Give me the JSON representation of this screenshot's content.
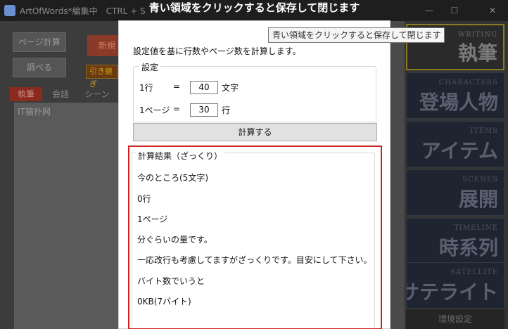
{
  "app": {
    "title": "ArtOfWords*編集中　CTRL + S",
    "min_icon": "minimize-icon",
    "max_icon": "maximize-icon",
    "close_icon": "close-icon",
    "buttons": {
      "page_calc": "ページ計算",
      "new": "新規",
      "lookup": "調べる",
      "quote": "引き継ぎ"
    },
    "tabs": [
      "執筆",
      "会話",
      "シーン"
    ],
    "editor_text": "IT猫扑网",
    "side_cards": [
      {
        "en": "WRITING",
        "jp": "執筆"
      },
      {
        "en": "CHARACTERS",
        "jp": "登場人物"
      },
      {
        "en": "ITEMS",
        "jp": "アイテム"
      },
      {
        "en": "SCENES",
        "jp": "展開"
      },
      {
        "en": "TIMELINE",
        "jp": "時系列"
      },
      {
        "en": "SATELLITE",
        "jp": "サテライト"
      }
    ],
    "bottom_button": "環境設定"
  },
  "banner": {
    "text": "青い領域をクリックすると保存して閉じます"
  },
  "tooltip": {
    "text": "青い領域をクリックすると保存して閉じます"
  },
  "dialog": {
    "description": "設定値を基に行数やページ数を計算します。",
    "settings": {
      "legend": "設定",
      "line_label": "1行",
      "line_eq": "=",
      "line_value": "40",
      "line_unit": "文字",
      "page_label": "1ページ",
      "page_eq": "=",
      "page_value": "30",
      "page_unit": "行"
    },
    "calc_button": "計算する",
    "results": {
      "legend": "計算結果（ざっくり）",
      "lines": [
        "今のところ(5文字)",
        "0行",
        "1ページ",
        "分ぐらいの量です。",
        "一応改行も考慮してますがざっくりです。目安にして下さい。",
        "バイト数でいうと",
        "0KB(7バイト)"
      ]
    }
  }
}
